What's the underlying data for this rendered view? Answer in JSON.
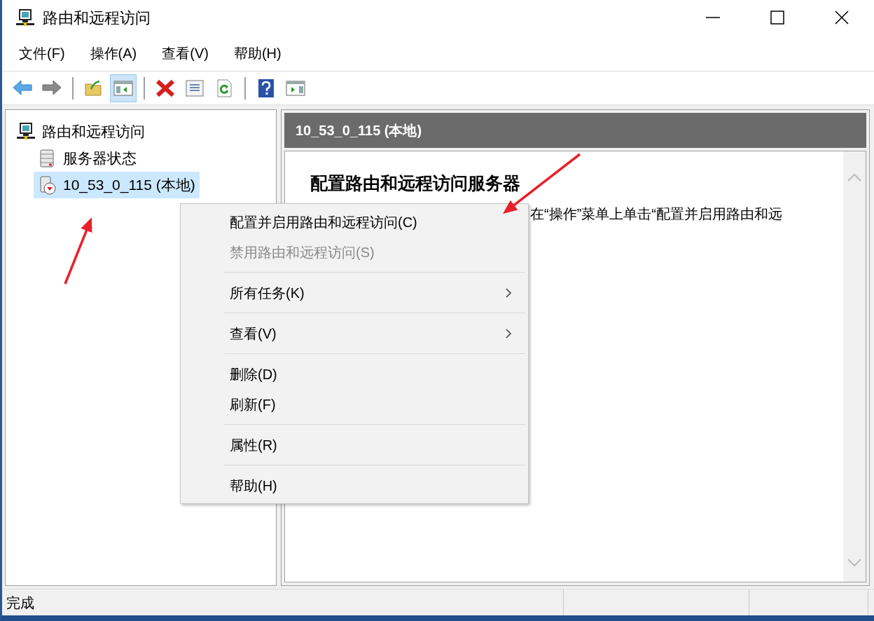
{
  "window": {
    "title": "路由和远程访问"
  },
  "menu_bar": [
    "文件(F)",
    "操作(A)",
    "查看(V)",
    "帮助(H)"
  ],
  "toolbar": [
    {
      "selected": false
    },
    {
      "selected": false
    },
    {
      "selected": false
    },
    {
      "selected": true
    },
    {
      "selected": false
    },
    {
      "selected": false
    },
    {
      "selected": false
    },
    {
      "selected": false
    },
    {
      "selected": false
    }
  ],
  "tree": {
    "label": "路由和远程访问",
    "selected": false,
    "children": [
      {
        "label": "服务器状态",
        "kind": "status",
        "selected": false
      },
      {
        "label": "10_53_0_115 (本地)",
        "kind": "server",
        "selected": true
      }
    ]
  },
  "details": {
    "header": "10_53_0_115 (本地)",
    "heading": "配置路由和远程访问服务器",
    "text": "在“操作”菜单上单击“配置并启用路由和远"
  },
  "context_menu": [
    {
      "kind": "item",
      "label": "配置并启用路由和远程访问(C)",
      "disabled": false,
      "submenu": false
    },
    {
      "kind": "item",
      "label": "禁用路由和远程访问(S)",
      "disabled": true,
      "submenu": false
    },
    {
      "kind": "separator"
    },
    {
      "kind": "item",
      "label": "所有任务(K)",
      "disabled": false,
      "submenu": true
    },
    {
      "kind": "separator"
    },
    {
      "kind": "item",
      "label": "查看(V)",
      "disabled": false,
      "submenu": true
    },
    {
      "kind": "separator"
    },
    {
      "kind": "item",
      "label": "删除(D)",
      "disabled": false,
      "submenu": false
    },
    {
      "kind": "item",
      "label": "刷新(F)",
      "disabled": false,
      "submenu": false
    },
    {
      "kind": "separator"
    },
    {
      "kind": "item",
      "label": "属性(R)",
      "disabled": false,
      "submenu": false
    },
    {
      "kind": "separator"
    },
    {
      "kind": "item",
      "label": "帮助(H)",
      "disabled": false,
      "submenu": false
    }
  ],
  "status_bar": [
    "完成"
  ]
}
